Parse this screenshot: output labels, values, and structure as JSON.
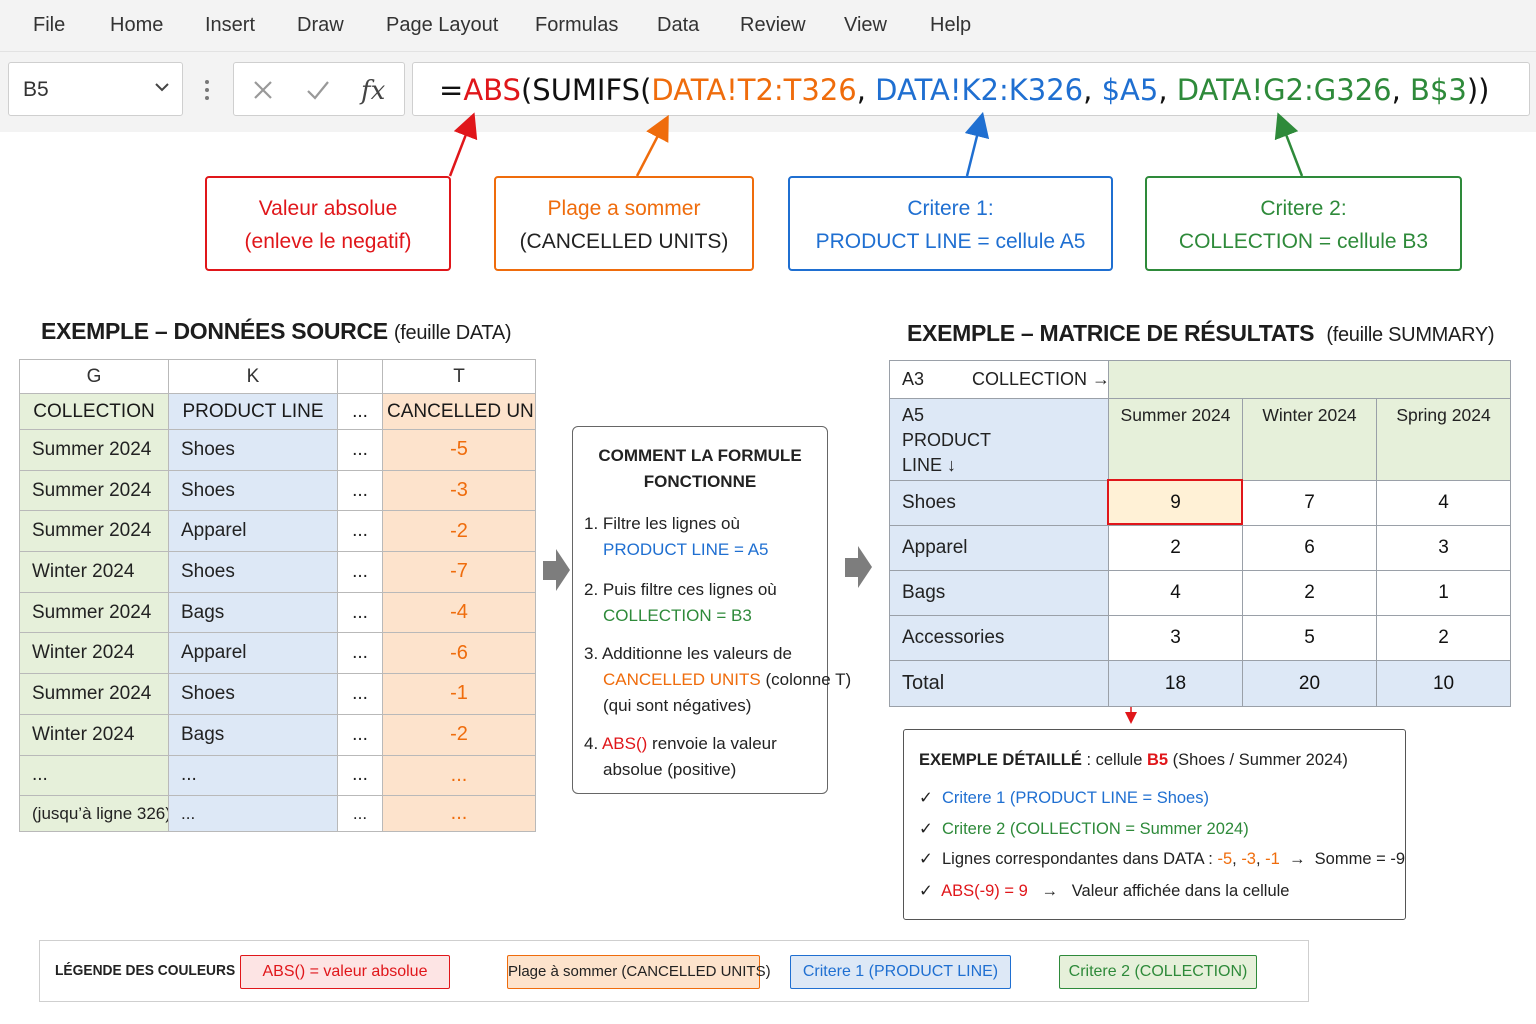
{
  "menu": [
    "File",
    "Home",
    "Insert",
    "Draw",
    "Page Layout",
    "Formulas",
    "Data",
    "Review",
    "View",
    "Help"
  ],
  "name_box": "B5",
  "formula": {
    "eq": "=",
    "abs": "ABS",
    "p1": "(",
    "sumifs": "SUMIFS(",
    "range_sum": "DATA!T2:T326",
    "c1": ", ",
    "range_crit1": "DATA!K2:K326",
    "c2": ", ",
    "crit1": "$A5",
    "c3": ", ",
    "range_crit2": "DATA!G2:G326",
    "c4": ", ",
    "crit2": "B$3",
    "close": "))"
  },
  "callouts": {
    "abs": {
      "line1": "Valeur absolue",
      "line2": "(enleve le negatif)"
    },
    "sum": {
      "line1": "Plage a sommer",
      "line2": "(CANCELLED UNITS)"
    },
    "crit1": {
      "line1": "Critere 1:",
      "line2": "PRODUCT LINE = cellule A5"
    },
    "crit2": {
      "line1": "Critere 2:",
      "line2": "COLLECTION = cellule B3"
    }
  },
  "source": {
    "title": "EXEMPLE  –  DONNÉES SOURCE",
    "subtitle": "(feuille DATA)",
    "col_letters": [
      "G",
      "K",
      "",
      "T"
    ],
    "headers": [
      "COLLECTION",
      "PRODUCT LINE",
      "...",
      "CANCELLED UNITS"
    ],
    "rows": [
      [
        "Summer 2024",
        "Shoes",
        "...",
        "-5"
      ],
      [
        "Summer 2024",
        "Shoes",
        "...",
        "-3"
      ],
      [
        "Summer 2024",
        "Apparel",
        "...",
        "-2"
      ],
      [
        "Winter 2024",
        "Shoes",
        "...",
        "-7"
      ],
      [
        "Summer 2024",
        "Bags",
        "...",
        "-4"
      ],
      [
        "Winter 2024",
        "Apparel",
        "...",
        "-6"
      ],
      [
        "Summer 2024",
        "Shoes",
        "...",
        "-1"
      ],
      [
        "Winter 2024",
        "Bags",
        "...",
        "-2"
      ],
      [
        "...",
        "...",
        "...",
        "..."
      ],
      [
        "(jusqu’à ligne 326)",
        "...",
        "...",
        "..."
      ]
    ]
  },
  "how": {
    "title_line1": "COMMENT LA FORMULE",
    "title_line2": "FONCTIONNE",
    "s1a": "1. Filtre les lignes où",
    "s1b": "PRODUCT LINE  =  A5",
    "s2a": "2. Puis filtre ces lignes où",
    "s2b": "COLLECTION  =  B3",
    "s3a": "3. Additionne les valeurs de",
    "s3b_colored": "CANCELLED UNITS",
    "s3b_rest": " (colonne T)",
    "s3c": "(qui sont négatives)",
    "s4a_num": "4. ",
    "s4a_colored": "ABS()",
    "s4a_rest": " renvoie la valeur",
    "s4b": "absolue (positive)"
  },
  "matrix": {
    "title": "EXEMPLE  –  MATRICE DE RÉSULTATS",
    "subtitle": "(feuille SUMMARY)",
    "a3": "A3",
    "collection_label": "COLLECTION →",
    "a5": "A5",
    "product_label1": "PRODUCT",
    "product_label2": "LINE  ↓",
    "columns": [
      "Summer 2024",
      "Winter 2024",
      "Spring 2024"
    ],
    "rows": [
      {
        "label": "Shoes",
        "values": [
          "9",
          "7",
          "4"
        ]
      },
      {
        "label": "Apparel",
        "values": [
          "2",
          "6",
          "3"
        ]
      },
      {
        "label": "Bags",
        "values": [
          "4",
          "2",
          "1"
        ]
      },
      {
        "label": "Accessories",
        "values": [
          "3",
          "5",
          "2"
        ]
      }
    ],
    "total": {
      "label": "Total",
      "values": [
        "18",
        "20",
        "10"
      ]
    }
  },
  "detail": {
    "title_bold": "EXEMPLE DÉTAILLÉ",
    "title_sep": " :  cellule ",
    "cell": "B5",
    "cell_desc": " (Shoes / Summer 2024)",
    "check": "✓",
    "l1": "Critere 1 (PRODUCT LINE = Shoes)",
    "l2": "Critere 2 (COLLECTION = Summer 2024)",
    "l3_pre": "Lignes correspondantes dans DATA : ",
    "l3_v1": "-5",
    "l3_v2": "-3",
    "l3_v3": "-1",
    "comma": ", ",
    "l3_arrow": "  →  ",
    "l3_sum": "Somme = -9",
    "l4_colored": "ABS(-9) = 9",
    "l4_arrow": "   →   ",
    "l4_rest": "Valeur affichée dans la cellule"
  },
  "legend": {
    "title": "LÉGENDE DES COULEURS",
    "abs": "ABS() = valeur absolue",
    "sum": "Plage à sommer (CANCELLED UNITS)",
    "crit1": "Critere 1 (PRODUCT LINE)",
    "crit2": "Critere 2 (COLLECTION)"
  },
  "colors": {
    "red": "#e0161a",
    "orange": "#ef6c0c",
    "blue": "#1f6fd1",
    "green": "#2e8a3a",
    "green_fill": "#e6f0da",
    "blue_fill": "#dde8f6",
    "orange_fill": "#fde3cc",
    "highlight_fill": "#fff1d6"
  },
  "icons": [
    "chevron-down-icon",
    "more-vertical-icon",
    "cancel-icon",
    "enter-icon",
    "fx-icon",
    "arrow-right-icon",
    "check-icon"
  ]
}
